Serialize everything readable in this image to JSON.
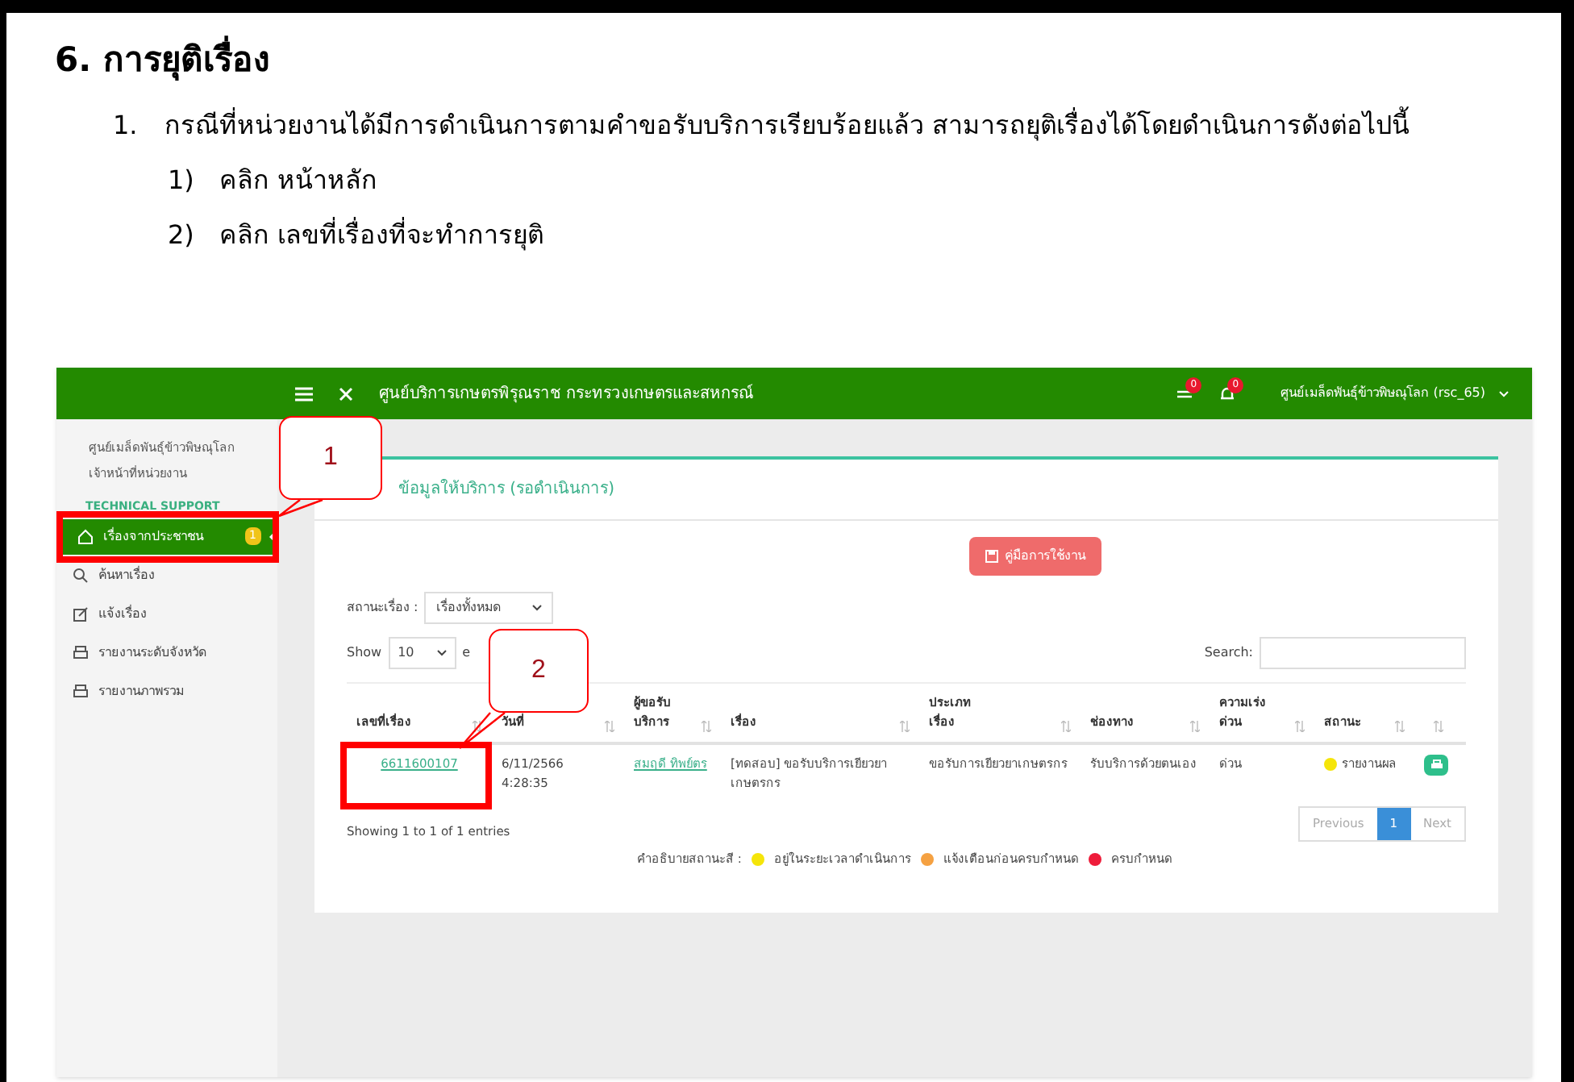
{
  "heading": "6. การยุติเรื่อง",
  "steps": [
    {
      "number": "1.",
      "text": "กรณีที่หน่วยงานได้มีการดำเนินการตามคำขอรับบริการเรียบร้อยแล้ว สามารถยุติเรื่องได้โดยดำเนินการดังต่อไปนี้",
      "children": [
        {
          "number": "1)",
          "text": "คลิก หน้าหลัก"
        },
        {
          "number": "2)",
          "text": "คลิก เลขที่เรื่องที่จะทำการยุติ"
        }
      ]
    }
  ],
  "screenshot": {
    "topbar": {
      "title": "ศูนย์บริการเกษตรพิรุณราช กระทรวงเกษตรและสหกรณ์",
      "transfer_badge": "0",
      "bell_badge": "0",
      "user": "ศูนย์เมล็ดพันธุ์ข้าวพิษณุโลก (rsc_65)"
    },
    "sidebar": {
      "org": "ศูนย์เมล็ดพันธุ์ข้าวพิษณุโลก",
      "role": "เจ้าหน้าที่หน่วยงาน",
      "section": "TECHNICAL SUPPORT",
      "items": [
        {
          "kind": "home",
          "label": "เรื่องจากประชาชน",
          "badge": "1",
          "selected": true
        },
        {
          "kind": "search",
          "label": "ค้นหาเรื่อง",
          "selected": false
        },
        {
          "kind": "edit",
          "label": "แจ้งเรื่อง",
          "selected": false
        },
        {
          "kind": "print",
          "label": "รายงานระดับจังหวัด",
          "selected": false
        },
        {
          "kind": "print",
          "label": "รายงานภาพรวม",
          "selected": false
        }
      ]
    },
    "card": {
      "title": "ข้อมูลให้บริการ (รอดำเนินการ)",
      "manual_button": "คู่มือการใช้งาน",
      "status_label": "สถานะเรื่อง :",
      "status_value": "เรื่องทั้งหมด",
      "show_label": "Show",
      "show_value": "10",
      "entries_label": "e",
      "search_label": "Search:",
      "columns": [
        "เลขที่เรื่อง",
        "วันที่",
        "ผู้ขอรับบริการ",
        "เรื่อง",
        "ประเภทเรื่อง",
        "ช่องทาง",
        "ความเร่งด่วน",
        "สถานะ",
        ""
      ],
      "rows": [
        {
          "id": "6611600107",
          "date": "6/11/2566",
          "time": "4:28:35",
          "requester": "สมฤดี ทิพย์ตร",
          "subject": "[ทดสอบ] ขอรับบริการเยียวยาเกษตรกร",
          "type": "ขอรับการเยียวยาเกษตรกร",
          "channel": "รับบริการด้วยตนเอง",
          "urgency": "ด่วน",
          "status": "รายงานผล",
          "color": "#f5e50a"
        }
      ],
      "info": "Showing 1 to 1 of 1 entries",
      "legend_label": "คำอธิบายสถานะสี :",
      "legend": [
        {
          "label": "อยู่ในระยะเวลาดำเนินการ",
          "color": "#f5e50a"
        },
        {
          "label": "แจ้งเตือนก่อนครบกำหนด",
          "color": "#f5a142"
        },
        {
          "label": "ครบกำหนด",
          "color": "#ee1c3a"
        }
      ],
      "pagination": [
        {
          "label": "Previous",
          "selected": false
        },
        {
          "label": "1",
          "selected": true
        },
        {
          "label": "Next",
          "selected": false
        }
      ]
    },
    "callouts": [
      "1",
      "2"
    ]
  }
}
